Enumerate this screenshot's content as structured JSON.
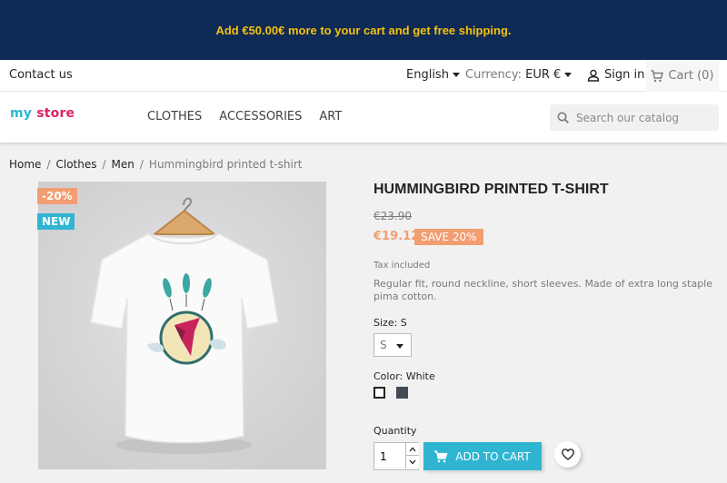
{
  "promo": {
    "text": "Add €50.00€ more to your cart and get free shipping."
  },
  "topbar": {
    "contact": "Contact us",
    "language": "English",
    "currency_label": "Currency:",
    "currency_value": "EUR €",
    "signin": "Sign in",
    "cart": "Cart (0)"
  },
  "header": {
    "logo": {
      "part1": "my",
      "part2": "store"
    },
    "menu": [
      "CLOTHES",
      "ACCESSORIES",
      "ART"
    ],
    "search_placeholder": "Search our catalog"
  },
  "breadcrumb": [
    "Home",
    "Clothes",
    "Men",
    "Hummingbird printed t-shirt"
  ],
  "product": {
    "flag_discount": "-20%",
    "flag_new": "NEW",
    "title": "HUMMINGBIRD PRINTED T-SHIRT",
    "regular_price": "€23.90",
    "price": "€19.12",
    "save": "SAVE 20%",
    "tax": "Tax included",
    "description": "Regular fit, round neckline, short sleeves. Made of extra long staple pima cotton.",
    "size_label": "Size: S",
    "size_value": "S",
    "color_label": "Color: White",
    "quantity_label": "Quantity",
    "quantity_value": "1",
    "add_to_cart": "ADD TO CART"
  },
  "colors": {
    "promo_bg": "#0f2a55",
    "promo_text": "#f4c20d",
    "accent": "#2fb5d2",
    "discount": "#f39d72",
    "swatch_grey": "#434a54"
  },
  "icons": [
    "user-icon",
    "cart-icon",
    "search-icon",
    "caret-down-icon",
    "heart-icon",
    "chevron-up-icon",
    "chevron-down-icon"
  ]
}
